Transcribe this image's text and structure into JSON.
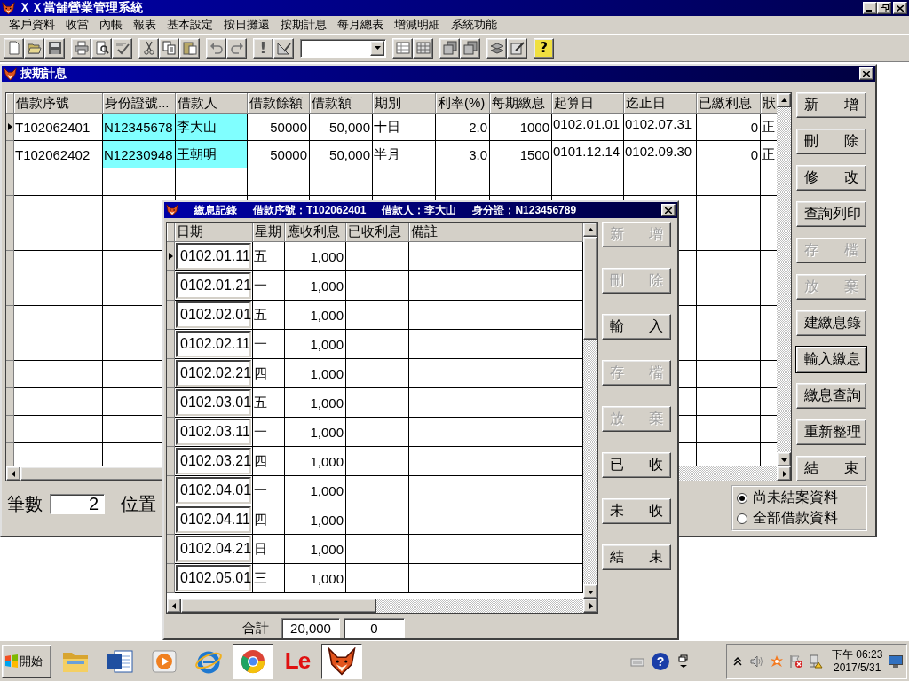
{
  "window": {
    "title": "ＸＸ當舖營業管理系統"
  },
  "menu": [
    "客戶資料",
    "收當",
    "內帳",
    "報表",
    "基本設定",
    "按日攤還",
    "按期計息",
    "每月總表",
    "增減明細",
    "系統功能"
  ],
  "toolbar": [
    {
      "kind": "new"
    },
    {
      "kind": "open"
    },
    {
      "kind": "save"
    },
    {
      "kind": "separator"
    },
    {
      "kind": "print"
    },
    {
      "kind": "preview"
    },
    {
      "kind": "spell"
    },
    {
      "kind": "separator"
    },
    {
      "kind": "cut"
    },
    {
      "kind": "copy"
    },
    {
      "kind": "paste"
    },
    {
      "kind": "separator"
    },
    {
      "kind": "undo"
    },
    {
      "kind": "redo"
    },
    {
      "kind": "separator"
    },
    {
      "kind": "alert",
      "text": "!"
    },
    {
      "kind": "ruler"
    },
    {
      "kind": "separator"
    },
    {
      "kind": "dropdown"
    },
    {
      "kind": "separator"
    },
    {
      "kind": "table"
    },
    {
      "kind": "grid"
    },
    {
      "kind": "separator"
    },
    {
      "kind": "stack"
    },
    {
      "kind": "stack"
    },
    {
      "kind": "separator"
    },
    {
      "kind": "layers"
    },
    {
      "kind": "edit"
    },
    {
      "kind": "separator"
    },
    {
      "kind": "help",
      "text": "?"
    }
  ],
  "loan_window": {
    "title": "按期計息",
    "columns": [
      {
        "label": "借款序號",
        "kind": "text",
        "highlight": false
      },
      {
        "label": "身份證號...",
        "kind": "text",
        "highlight": true
      },
      {
        "label": "借款人",
        "kind": "text",
        "highlight": true
      },
      {
        "label": "借款餘額",
        "kind": "number",
        "highlight": false
      },
      {
        "label": "借款額",
        "kind": "number",
        "highlight": false
      },
      {
        "label": "期別",
        "kind": "text",
        "highlight": false
      },
      {
        "label": "利率(%)",
        "kind": "number",
        "highlight": false
      },
      {
        "label": "每期繳息",
        "kind": "number",
        "highlight": false
      },
      {
        "label": "起算日",
        "kind": "date",
        "highlight": false
      },
      {
        "label": "迄止日",
        "kind": "date",
        "highlight": false
      },
      {
        "label": "已繳利息",
        "kind": "number",
        "highlight": false
      },
      {
        "label": "狀",
        "kind": "text",
        "highlight": false
      }
    ],
    "rows": [
      {
        "selected": true,
        "cells": [
          "T102062401",
          "N12345678",
          "李大山",
          "50000",
          "50,000",
          "十日",
          "2.0",
          "1000",
          "0102.01.01",
          "0102.07.31",
          "0",
          "正"
        ]
      },
      {
        "selected": false,
        "cells": [
          "T102062402",
          "N12230948",
          "王朝明",
          "50000",
          "50,000",
          "半月",
          "3.0",
          "1500",
          "0101.12.14",
          "0102.09.30",
          "0",
          "正"
        ]
      }
    ],
    "buttons": [
      {
        "label": "新 增",
        "disabled": false,
        "focused": false
      },
      {
        "label": "刪 除",
        "disabled": false,
        "focused": false
      },
      {
        "label": "修 改",
        "disabled": false,
        "focused": false
      },
      {
        "label": "查詢列印",
        "disabled": false,
        "focused": false
      },
      {
        "label": "存 檔",
        "disabled": true,
        "focused": false
      },
      {
        "label": "放 棄",
        "disabled": true,
        "focused": false
      },
      {
        "label": "建繳息錄",
        "disabled": false,
        "focused": false
      },
      {
        "label": "輸入繳息",
        "disabled": false,
        "focused": true
      },
      {
        "label": "繳息查詢",
        "disabled": false,
        "focused": false
      },
      {
        "label": "重新整理",
        "disabled": false,
        "focused": false
      },
      {
        "label": "結 束",
        "disabled": false,
        "focused": false
      }
    ],
    "filter": [
      {
        "label": "尚未結案資料",
        "selected": true
      },
      {
        "label": "全部借款資料",
        "selected": false
      }
    ],
    "count_label": "筆數",
    "count": "2",
    "position_label": "位置"
  },
  "payment_window": {
    "title_parts": [
      "繳息記錄",
      "借款序號：T102062401",
      "借款人：李大山",
      "身分證：N123456789"
    ],
    "columns": [
      {
        "label": "日期",
        "kind": "input"
      },
      {
        "label": "星期",
        "kind": "text"
      },
      {
        "label": "應收利息",
        "kind": "number"
      },
      {
        "label": "已收利息"
      },
      {
        "label": "備註"
      }
    ],
    "rows": [
      {
        "selected": true,
        "cells": [
          "0102.01.11",
          "五",
          "1,000"
        ]
      },
      {
        "selected": false,
        "cells": [
          "0102.01.21",
          "一",
          "1,000"
        ]
      },
      {
        "selected": false,
        "cells": [
          "0102.02.01",
          "五",
          "1,000"
        ]
      },
      {
        "selected": false,
        "cells": [
          "0102.02.11",
          "一",
          "1,000"
        ]
      },
      {
        "selected": false,
        "cells": [
          "0102.02.21",
          "四",
          "1,000"
        ]
      },
      {
        "selected": false,
        "cells": [
          "0102.03.01",
          "五",
          "1,000"
        ]
      },
      {
        "selected": false,
        "cells": [
          "0102.03.11",
          "一",
          "1,000"
        ]
      },
      {
        "selected": false,
        "cells": [
          "0102.03.21",
          "四",
          "1,000"
        ]
      },
      {
        "selected": false,
        "cells": [
          "0102.04.01",
          "一",
          "1,000"
        ]
      },
      {
        "selected": false,
        "cells": [
          "0102.04.11",
          "四",
          "1,000"
        ]
      },
      {
        "selected": false,
        "cells": [
          "0102.04.21",
          "日",
          "1,000"
        ]
      },
      {
        "selected": false,
        "cells": [
          "0102.05.01",
          "三",
          "1,000"
        ]
      }
    ],
    "buttons": [
      {
        "label": "新 增",
        "disabled": true
      },
      {
        "label": "刪 除",
        "disabled": true
      },
      {
        "label": "輸 入",
        "disabled": false
      },
      {
        "label": "存 檔",
        "disabled": true
      },
      {
        "label": "放 棄",
        "disabled": true
      },
      {
        "label": "已 收",
        "disabled": false
      },
      {
        "label": "未 收",
        "disabled": false
      },
      {
        "label": "結 束",
        "disabled": false
      }
    ],
    "total_label": "合計",
    "totals": [
      "20,000",
      "0"
    ]
  },
  "taskbar": {
    "start": "開始",
    "apps": [
      {
        "kind": "folder",
        "selected": false
      },
      {
        "kind": "word",
        "selected": false
      },
      {
        "kind": "media",
        "selected": false
      },
      {
        "kind": "ie",
        "selected": false
      },
      {
        "kind": "chrome",
        "selected": true
      },
      {
        "kind": "le",
        "text": "Le",
        "selected": false
      },
      {
        "kind": "fox",
        "selected": true
      }
    ],
    "tools": [
      {
        "kind": "keyboard"
      },
      {
        "kind": "help",
        "text": "?"
      },
      {
        "kind": "window"
      }
    ],
    "tray": [
      {
        "kind": "chevron"
      },
      {
        "kind": "speaker"
      },
      {
        "kind": "splash"
      },
      {
        "kind": "flag"
      },
      {
        "kind": "network"
      }
    ],
    "clock": {
      "time": "下午 06:23",
      "date": "2017/5/31"
    }
  }
}
